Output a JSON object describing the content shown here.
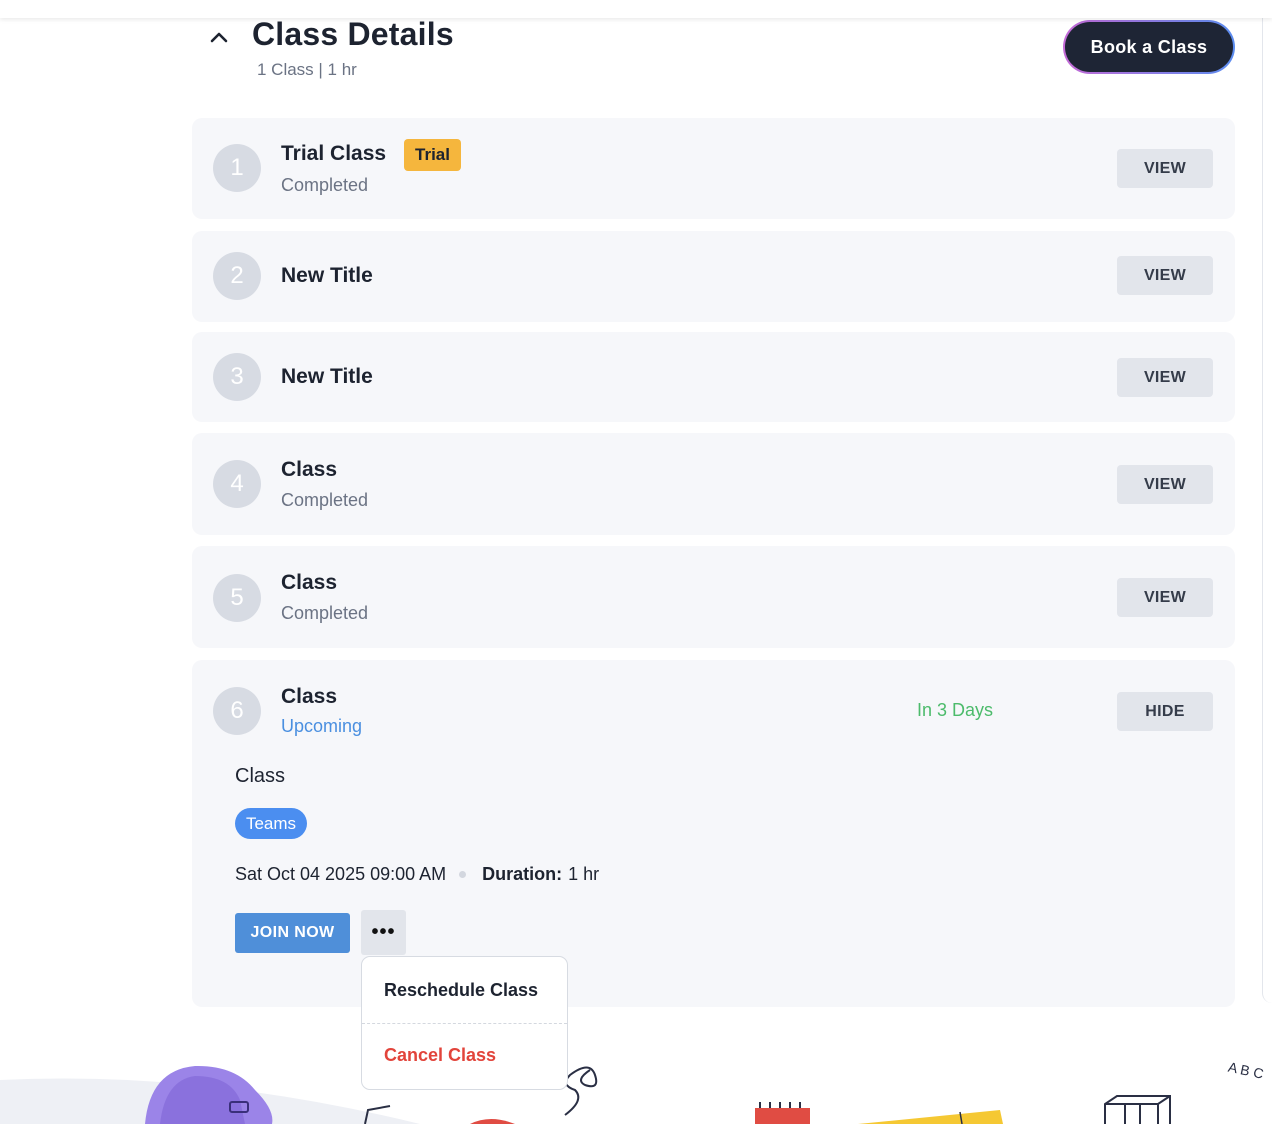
{
  "header": {
    "title": "Class Details",
    "subtitle": "1 Class | 1 hr",
    "book_label": "Book a Class"
  },
  "classes": [
    {
      "number": "1",
      "title": "Trial Class",
      "badge": "Trial",
      "status": "Completed",
      "action": "VIEW"
    },
    {
      "number": "2",
      "title": "New Title",
      "action": "VIEW"
    },
    {
      "number": "3",
      "title": "New Title",
      "action": "VIEW"
    },
    {
      "number": "4",
      "title": "Class",
      "status": "Completed",
      "action": "VIEW"
    },
    {
      "number": "5",
      "title": "Class",
      "status": "Completed",
      "action": "VIEW"
    },
    {
      "number": "6",
      "title": "Class",
      "status": "Upcoming",
      "countdown": "In 3 Days",
      "action": "HIDE"
    }
  ],
  "expanded": {
    "name": "Class",
    "platform": "Teams",
    "datetime": "Sat Oct 04 2025 09:00 AM",
    "duration_label": "Duration:",
    "duration_value": "1 hr",
    "join_label": "JOIN NOW",
    "more_label": "•••"
  },
  "menu": {
    "reschedule": "Reschedule Class",
    "cancel": "Cancel Class"
  },
  "decor": {
    "abc": "A B C"
  },
  "colors": {
    "trial_badge": "#f5b63d",
    "teams_badge": "#4b8ef0",
    "join_button": "#4f8fd9",
    "countdown": "#4cbb6b",
    "cancel": "#e2443b",
    "book_button": "#1e2535"
  }
}
